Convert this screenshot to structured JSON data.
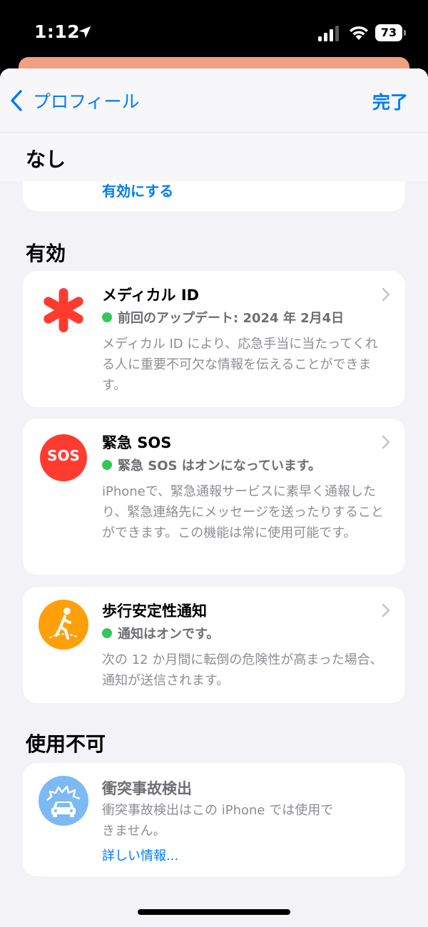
{
  "status_bar": {
    "time": "1:12",
    "battery": "73"
  },
  "nav": {
    "back_label": "プロフィール",
    "done_label": "完了"
  },
  "sections": {
    "none": {
      "title": "なし",
      "action_link": "有効にする"
    },
    "enabled": {
      "title": "有効",
      "items": [
        {
          "title": "メディカル ID",
          "status": "前回のアップデート: 2024 年 2月4日",
          "description": "メディカル ID により、応急手当に当たってくれる人に重要不可欠な情報を伝えることができます。"
        },
        {
          "title": "緊急 SOS",
          "icon_text": "SOS",
          "status": "緊急 SOS はオンになっています。",
          "description": "iPhoneで、緊急通報サービスに素早く通報したり、緊急連絡先にメッセージを送ったりすることができます。この機能は常に使用可能です。"
        },
        {
          "title": "歩行安定性通知",
          "status": "通知はオンです。",
          "description": "次の 12 か月間に転倒の危険性が高まった場合、通知が送信されます。"
        }
      ]
    },
    "unavailable": {
      "title": "使用不可",
      "items": [
        {
          "title": "衝突事故検出",
          "description": "衝突事故検出はこの iPhone では使用できません。",
          "link": "詳しい情報..."
        }
      ]
    }
  },
  "colors": {
    "accent": "#007aff",
    "medical_red": "#ff3b30",
    "sos_red": "#ff3b30",
    "walking_orange": "#ff9f0a",
    "crash_blue": "#7db9f5",
    "status_green": "#34c759"
  },
  "icons": [
    "location-arrow-icon",
    "cellular-signal-icon",
    "wifi-icon",
    "battery-icon",
    "chevron-left-icon",
    "medical-star-icon",
    "sos-icon",
    "walking-steadiness-icon",
    "crash-detection-icon",
    "chevron-right-icon"
  ]
}
